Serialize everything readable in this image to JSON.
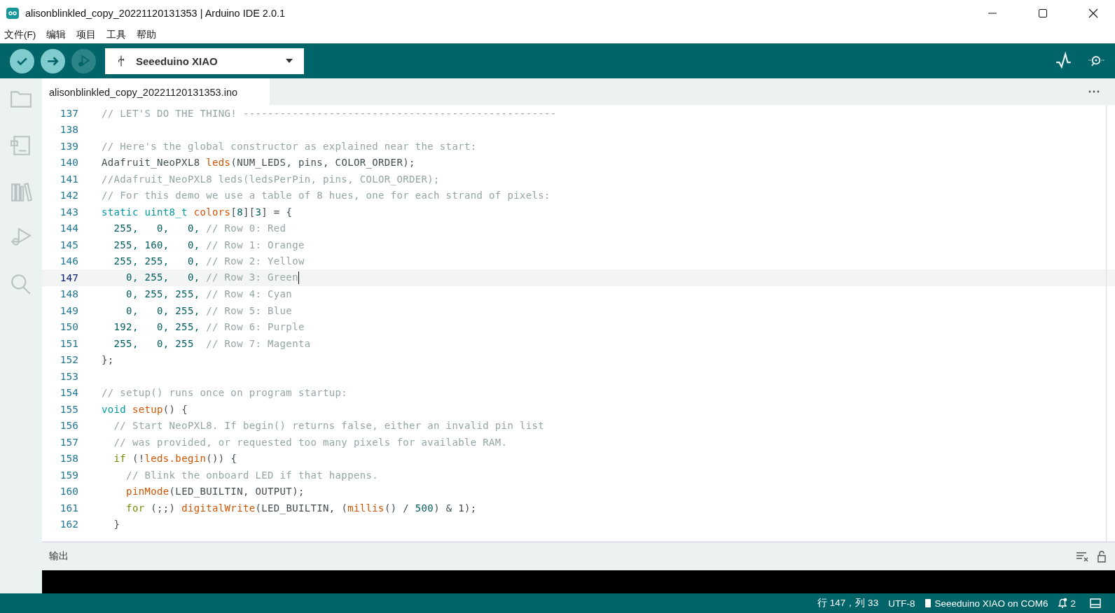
{
  "window": {
    "title": "alisonblinkled_copy_20221120131353 | Arduino IDE 2.0.1"
  },
  "menu": [
    "文件(F)",
    "编辑",
    "项目",
    "工具",
    "帮助"
  ],
  "toolbar": {
    "board": "Seeeduino XIAO",
    "buttons": [
      {
        "kind": "verify",
        "disabled": false
      },
      {
        "kind": "upload",
        "disabled": false
      },
      {
        "kind": "debug",
        "disabled": true
      }
    ]
  },
  "sidebar": {
    "items": [
      {
        "kind": "folder",
        "selected": false
      },
      {
        "kind": "boards",
        "selected": false
      },
      {
        "kind": "library",
        "selected": false
      },
      {
        "kind": "debug",
        "selected": false
      },
      {
        "kind": "search",
        "selected": false
      }
    ]
  },
  "tabs": [
    {
      "label": "alisonblinkled_copy_20221120131353.ino",
      "selected": true
    }
  ],
  "editor": {
    "lines": [
      {
        "number": "137",
        "current": false,
        "tokens": [
          {
            "kind": "comment",
            "text": "// LET'S DO THE THING! ---------------------------------------------------"
          }
        ]
      },
      {
        "number": "138",
        "current": false
      },
      {
        "number": "139",
        "current": false,
        "tokens": [
          {
            "kind": "comment",
            "text": "// Here's the global constructor as explained near the start:"
          }
        ]
      },
      {
        "number": "140",
        "current": false,
        "tokens": [
          {
            "kind": "plain",
            "text": "Adafruit_NeoPXL8 "
          },
          {
            "kind": "func",
            "text": "leds"
          },
          {
            "kind": "plain",
            "text": "(NUM_LEDS, pins, COLOR_ORDER);"
          }
        ]
      },
      {
        "number": "141",
        "current": false,
        "tokens": [
          {
            "kind": "comment",
            "text": "//Adafruit_NeoPXL8 leds(ledsPerPin, pins, COLOR_ORDER);"
          }
        ]
      },
      {
        "number": "142",
        "current": false,
        "tokens": [
          {
            "kind": "comment",
            "text": "// For this demo we use a table of 8 hues, one for each strand of pixels:"
          }
        ]
      },
      {
        "number": "143",
        "current": false,
        "tokens": [
          {
            "kind": "keyword",
            "text": "static uint8_t "
          },
          {
            "kind": "func",
            "text": "colors"
          },
          {
            "kind": "plain",
            "text": "["
          },
          {
            "kind": "number",
            "text": "8"
          },
          {
            "kind": "plain",
            "text": "]["
          },
          {
            "kind": "number",
            "text": "3"
          },
          {
            "kind": "plain",
            "text": "] = {"
          }
        ]
      },
      {
        "number": "144",
        "current": false,
        "tokens": [
          {
            "kind": "number",
            "text": "  255,   0,   0, "
          },
          {
            "kind": "comment",
            "text": "// Row 0: Red"
          }
        ]
      },
      {
        "number": "145",
        "current": false,
        "tokens": [
          {
            "kind": "number",
            "text": "  255, 160,   0, "
          },
          {
            "kind": "comment",
            "text": "// Row 1: Orange"
          }
        ]
      },
      {
        "number": "146",
        "current": false,
        "tokens": [
          {
            "kind": "number",
            "text": "  255, 255,   0, "
          },
          {
            "kind": "comment",
            "text": "// Row 2: Yellow"
          }
        ]
      },
      {
        "number": "147",
        "current": true,
        "tokens": [
          {
            "kind": "number",
            "text": "    0, 255,   0, "
          },
          {
            "kind": "comment",
            "text": "// Row 3: Green"
          }
        ]
      },
      {
        "number": "148",
        "current": false,
        "tokens": [
          {
            "kind": "number",
            "text": "    0, 255, 255, "
          },
          {
            "kind": "comment",
            "text": "// Row 4: Cyan"
          }
        ]
      },
      {
        "number": "149",
        "current": false,
        "tokens": [
          {
            "kind": "number",
            "text": "    0,   0, 255, "
          },
          {
            "kind": "comment",
            "text": "// Row 5: Blue"
          }
        ]
      },
      {
        "number": "150",
        "current": false,
        "tokens": [
          {
            "kind": "number",
            "text": "  192,   0, 255, "
          },
          {
            "kind": "comment",
            "text": "// Row 6: Purple"
          }
        ]
      },
      {
        "number": "151",
        "current": false,
        "tokens": [
          {
            "kind": "number",
            "text": "  255,   0, 255  "
          },
          {
            "kind": "comment",
            "text": "// Row 7: Magenta"
          }
        ]
      },
      {
        "number": "152",
        "current": false,
        "tokens": [
          {
            "kind": "plain",
            "text": "};"
          }
        ]
      },
      {
        "number": "153",
        "current": false
      },
      {
        "number": "154",
        "current": false,
        "tokens": [
          {
            "kind": "comment",
            "text": "// setup() runs once on program startup:"
          }
        ]
      },
      {
        "number": "155",
        "current": false,
        "tokens": [
          {
            "kind": "keyword",
            "text": "void "
          },
          {
            "kind": "func",
            "text": "setup"
          },
          {
            "kind": "plain",
            "text": "() {"
          }
        ]
      },
      {
        "number": "156",
        "current": false,
        "tokens": [
          {
            "kind": "comment",
            "text": "  // Start NeoPXL8. If begin() returns false, either an invalid pin list"
          }
        ]
      },
      {
        "number": "157",
        "current": false,
        "tokens": [
          {
            "kind": "comment",
            "text": "  // was provided, or requested too many pixels for available RAM."
          }
        ]
      },
      {
        "number": "158",
        "current": false,
        "tokens": [
          {
            "kind": "control",
            "text": "  if "
          },
          {
            "kind": "plain",
            "text": "(!"
          },
          {
            "kind": "func",
            "text": "leds.begin"
          },
          {
            "kind": "plain",
            "text": "()) {"
          }
        ]
      },
      {
        "number": "159",
        "current": false,
        "tokens": [
          {
            "kind": "comment",
            "text": "    // Blink the onboard LED if that happens."
          }
        ]
      },
      {
        "number": "160",
        "current": false,
        "tokens": [
          {
            "kind": "func",
            "text": "    pinMode"
          },
          {
            "kind": "plain",
            "text": "(LED_BUILTIN, OUTPUT);"
          }
        ]
      },
      {
        "number": "161",
        "current": false,
        "tokens": [
          {
            "kind": "control",
            "text": "    for "
          },
          {
            "kind": "plain",
            "text": "(;;) "
          },
          {
            "kind": "func",
            "text": "digitalWrite"
          },
          {
            "kind": "plain",
            "text": "(LED_BUILTIN, ("
          },
          {
            "kind": "func",
            "text": "millis"
          },
          {
            "kind": "plain",
            "text": "() / "
          },
          {
            "kind": "number",
            "text": "500"
          },
          {
            "kind": "plain",
            "text": ") & 1);"
          }
        ]
      },
      {
        "number": "162",
        "current": false,
        "tokens": [
          {
            "kind": "plain",
            "text": "  }"
          }
        ]
      }
    ]
  },
  "output": {
    "title": "输出"
  },
  "status_bar": {
    "position": "行 147，列 33",
    "encoding": "UTF-8",
    "board": "Seeeduino XIAO on COM6",
    "notifications": "2"
  }
}
